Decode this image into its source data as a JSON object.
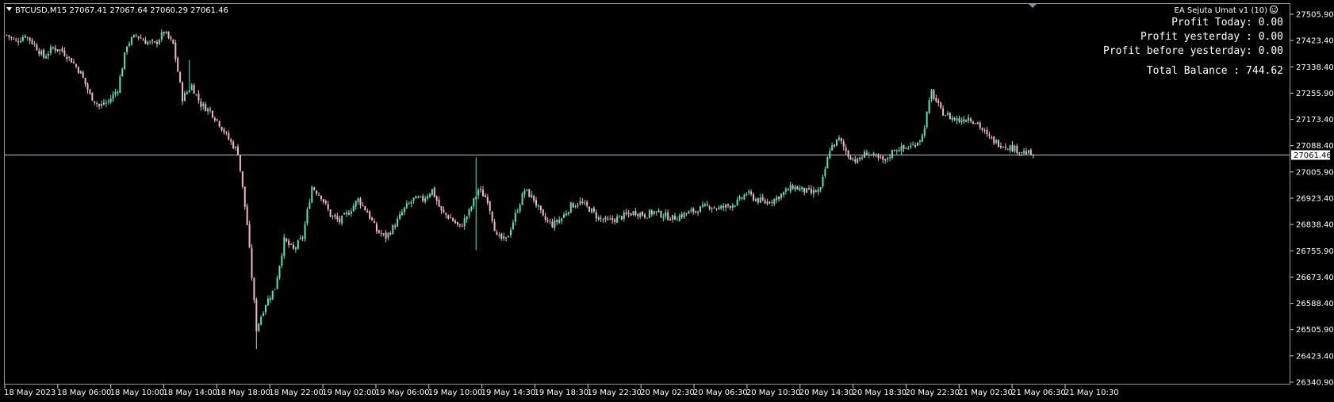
{
  "header": {
    "symbol_info": "BTCUSD,M15  27067.41 27067.64 27060.29 27061.46",
    "ea_label": "EA Sejuta Umat v1 (10)"
  },
  "overlay": {
    "profit_today": "Profit Today: 0.00",
    "profit_yesterday": "Profit yesterday : 0.00",
    "profit_before_yesterday": "Profit before yesterday: 0.00",
    "total_balance": "Total Balance : 744.62"
  },
  "colors": {
    "background": "#000000",
    "bull_candle": "#5fe0b8",
    "bear_candle": "#f2b8c6",
    "price_line": "#b8c2c8",
    "frame": "#9a9a9a",
    "text": "#ffffff"
  },
  "chart_data": {
    "type": "candlestick",
    "symbol": "BTCUSD",
    "timeframe": "M15",
    "bid_line": 27061.46,
    "ylim": [
      26340.9,
      27550
    ],
    "y_ticks": [
      "27505.90",
      "27423.40",
      "27338.40",
      "27255.90",
      "27173.40",
      "27088.40",
      "27005.90",
      "26923.40",
      "26838.40",
      "26755.90",
      "26673.40",
      "26588.40",
      "26505.90",
      "26423.40",
      "26340.90"
    ],
    "x_ticks": [
      "18 May 2023",
      "18 May 06:00",
      "18 May 10:00",
      "18 May 14:00",
      "18 May 18:00",
      "18 May 22:00",
      "19 May 02:00",
      "19 May 06:00",
      "19 May 10:00",
      "19 May 14:30",
      "19 May 18:30",
      "19 May 22:30",
      "20 May 02:30",
      "20 May 06:30",
      "20 May 10:30",
      "20 May 14:30",
      "20 May 18:30",
      "20 May 22:30",
      "21 May 02:30",
      "21 May 06:30",
      "21 May 10:30"
    ],
    "close_path": [
      [
        0,
        27440
      ],
      [
        4,
        27420
      ],
      [
        8,
        27440
      ],
      [
        12,
        27410
      ],
      [
        16,
        27370
      ],
      [
        20,
        27400
      ],
      [
        24,
        27390
      ],
      [
        28,
        27360
      ],
      [
        32,
        27320
      ],
      [
        36,
        27250
      ],
      [
        40,
        27215
      ],
      [
        44,
        27230
      ],
      [
        48,
        27270
      ],
      [
        52,
        27410
      ],
      [
        56,
        27440
      ],
      [
        60,
        27420
      ],
      [
        64,
        27410
      ],
      [
        68,
        27450
      ],
      [
        72,
        27410
      ],
      [
        76,
        27240
      ],
      [
        80,
        27280
      ],
      [
        84,
        27220
      ],
      [
        88,
        27200
      ],
      [
        92,
        27160
      ],
      [
        96,
        27110
      ],
      [
        100,
        27070
      ],
      [
        104,
        26840
      ],
      [
        108,
        26510
      ],
      [
        112,
        26590
      ],
      [
        116,
        26640
      ],
      [
        120,
        26790
      ],
      [
        124,
        26760
      ],
      [
        128,
        26800
      ],
      [
        132,
        26960
      ],
      [
        136,
        26930
      ],
      [
        140,
        26870
      ],
      [
        144,
        26850
      ],
      [
        148,
        26880
      ],
      [
        152,
        26920
      ],
      [
        156,
        26880
      ],
      [
        160,
        26820
      ],
      [
        164,
        26800
      ],
      [
        168,
        26840
      ],
      [
        172,
        26890
      ],
      [
        176,
        26920
      ],
      [
        180,
        26920
      ],
      [
        184,
        26950
      ],
      [
        188,
        26880
      ],
      [
        192,
        26860
      ],
      [
        196,
        26830
      ],
      [
        200,
        26880
      ],
      [
        204,
        26950
      ],
      [
        208,
        26920
      ],
      [
        212,
        26800
      ],
      [
        216,
        26790
      ],
      [
        220,
        26870
      ],
      [
        224,
        26950
      ],
      [
        228,
        26920
      ],
      [
        232,
        26860
      ],
      [
        236,
        26840
      ],
      [
        240,
        26860
      ],
      [
        244,
        26900
      ],
      [
        248,
        26910
      ],
      [
        252,
        26890
      ],
      [
        256,
        26860
      ],
      [
        260,
        26850
      ],
      [
        264,
        26860
      ],
      [
        268,
        26870
      ],
      [
        272,
        26880
      ],
      [
        276,
        26870
      ],
      [
        280,
        26880
      ],
      [
        284,
        26870
      ],
      [
        288,
        26860
      ],
      [
        292,
        26870
      ],
      [
        296,
        26880
      ],
      [
        300,
        26890
      ],
      [
        304,
        26900
      ],
      [
        308,
        26890
      ],
      [
        312,
        26900
      ],
      [
        316,
        26910
      ],
      [
        320,
        26940
      ],
      [
        324,
        26920
      ],
      [
        328,
        26910
      ],
      [
        332,
        26920
      ],
      [
        336,
        26940
      ],
      [
        340,
        26960
      ],
      [
        344,
        26950
      ],
      [
        348,
        26940
      ],
      [
        352,
        26950
      ],
      [
        356,
        27080
      ],
      [
        360,
        27110
      ],
      [
        364,
        27060
      ],
      [
        368,
        27040
      ],
      [
        372,
        27070
      ],
      [
        376,
        27050
      ],
      [
        380,
        27040
      ],
      [
        384,
        27080
      ],
      [
        388,
        27080
      ],
      [
        392,
        27090
      ],
      [
        396,
        27120
      ],
      [
        400,
        27260
      ],
      [
        404,
        27200
      ],
      [
        408,
        27180
      ],
      [
        412,
        27170
      ],
      [
        416,
        27180
      ],
      [
        420,
        27160
      ],
      [
        424,
        27120
      ],
      [
        428,
        27100
      ],
      [
        432,
        27090
      ],
      [
        436,
        27080
      ],
      [
        440,
        27070
      ],
      [
        444,
        27061.46
      ]
    ]
  }
}
